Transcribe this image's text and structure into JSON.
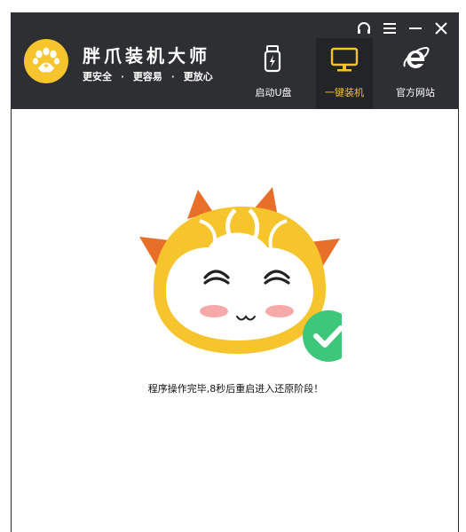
{
  "app": {
    "name": "胖爪装机大师",
    "slogan": [
      "更安全",
      "·",
      "更容易",
      "·",
      "更放心"
    ]
  },
  "window_controls": {
    "support": "headset-icon",
    "menu": "menu-icon",
    "minimize": "minimize-icon",
    "close": "close-icon"
  },
  "nav": [
    {
      "label": "启动U盘",
      "icon": "usb-drive-icon",
      "active": false
    },
    {
      "label": "一键装机",
      "icon": "monitor-icon",
      "active": true
    },
    {
      "label": "官方网站",
      "icon": "ie-browser-icon",
      "active": false
    }
  ],
  "colors": {
    "accent": "#f5c12d",
    "header": "#2e2f33",
    "success": "#3dc77a"
  },
  "status": {
    "message": "程序操作完毕,8秒后重启进入还原阶段！"
  }
}
